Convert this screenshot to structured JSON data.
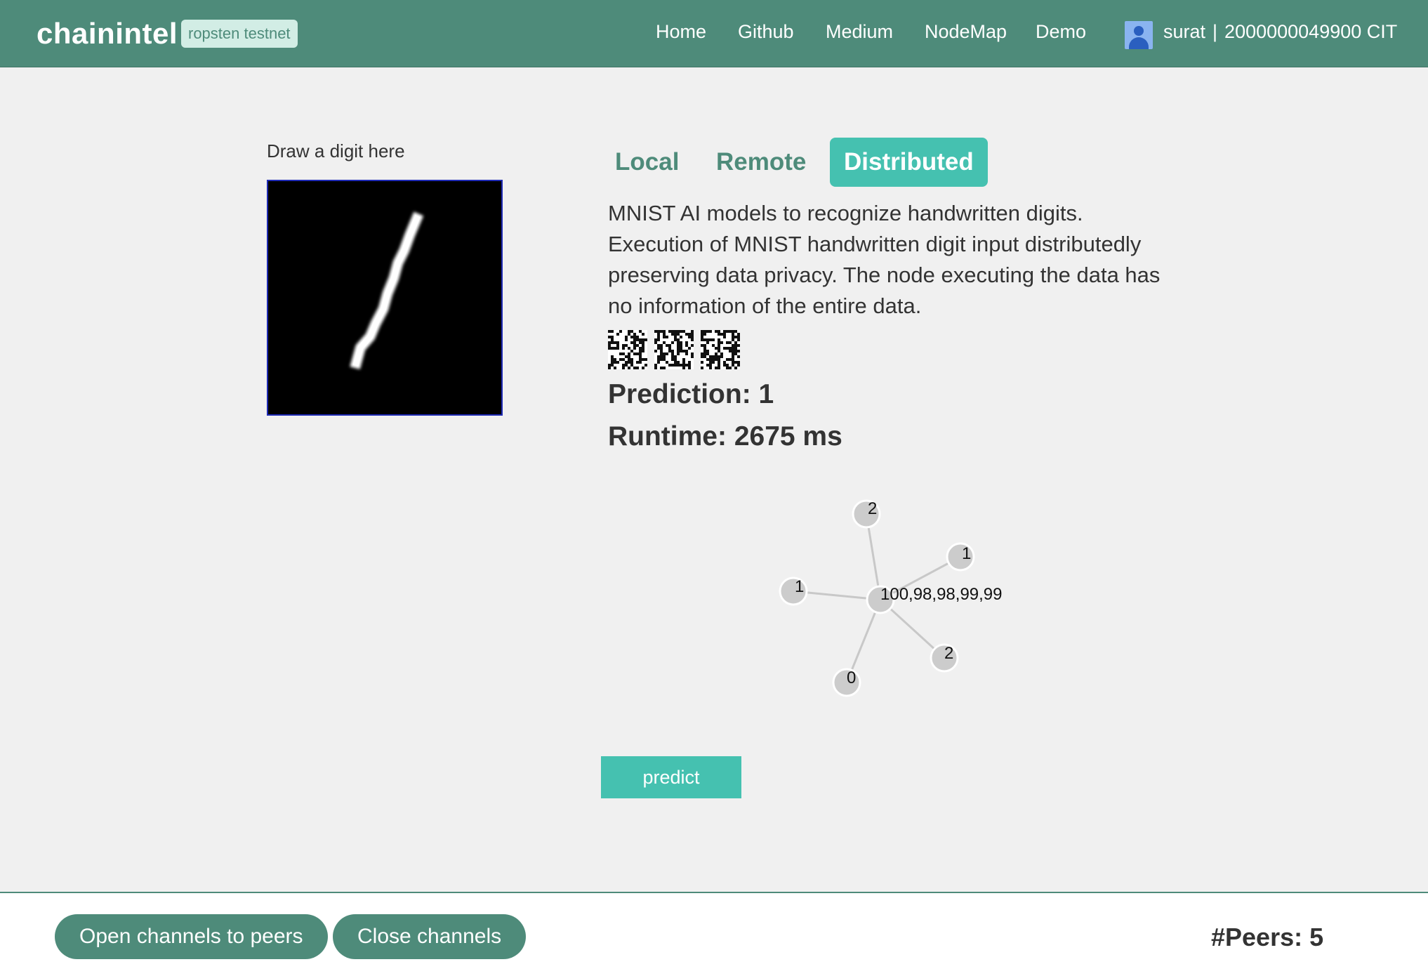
{
  "header": {
    "brand": "chainintel",
    "network_badge": "ropsten testnet",
    "nav": [
      {
        "label": "Home"
      },
      {
        "label": "Github"
      },
      {
        "label": "Medium"
      },
      {
        "label": "NodeMap"
      },
      {
        "label": "Demo"
      }
    ],
    "account": {
      "username": "surat",
      "separator": "|",
      "balance": "2000000049900 CIT"
    }
  },
  "left_panel": {
    "draw_label": "Draw a digit here"
  },
  "tabs": [
    {
      "label": "Local",
      "active": false
    },
    {
      "label": "Remote",
      "active": false
    },
    {
      "label": "Distributed",
      "active": true
    }
  ],
  "description": "MNIST AI models to recognize handwritten digits. Execution of MNIST handwritten digit input distributedly preserving data privacy. The node executing the data has no information of the entire data.",
  "result": {
    "prediction": "Prediction: 1",
    "runtime": "Runtime: 2675 ms"
  },
  "graph": {
    "center_label": "100,98,98,99,99",
    "peer_labels": [
      "2",
      "1",
      "1",
      "2",
      "0"
    ]
  },
  "predict_button": "predict",
  "footer": {
    "open_channels": "Open channels to peers",
    "close_channels": "Close channels",
    "peers": "#Peers: 5"
  },
  "colors": {
    "header": "#4e8b7a",
    "accent": "#45c1b0",
    "badge_bg": "#d2ede5",
    "background": "#f0f0f0",
    "node": "#cccccc"
  }
}
